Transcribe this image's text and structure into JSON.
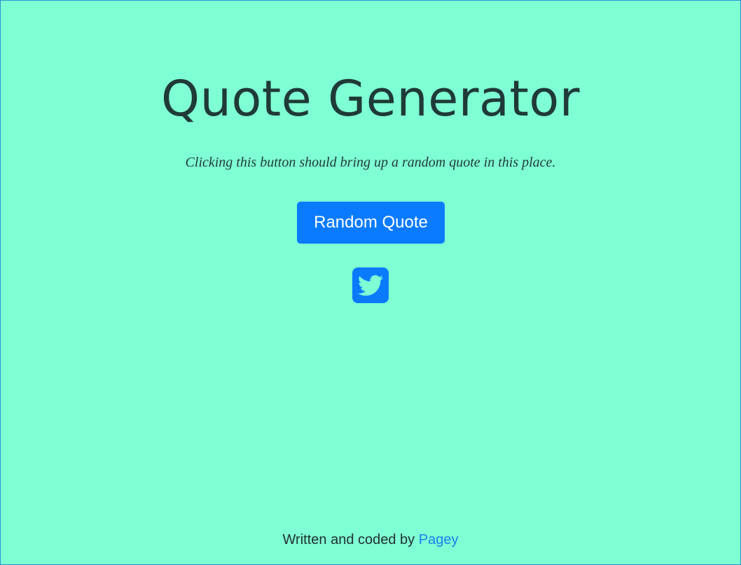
{
  "header": {
    "title": "Quote Generator"
  },
  "quote": {
    "text": "Clicking this button should bring up a random quote in this place."
  },
  "actions": {
    "random_label": "Random Quote",
    "tweet_icon": "twitter-icon"
  },
  "footer": {
    "prefix": "Written and coded by ",
    "author_link": "Pagey"
  },
  "colors": {
    "background": "#7fffd4",
    "accent": "#0a7bff"
  }
}
